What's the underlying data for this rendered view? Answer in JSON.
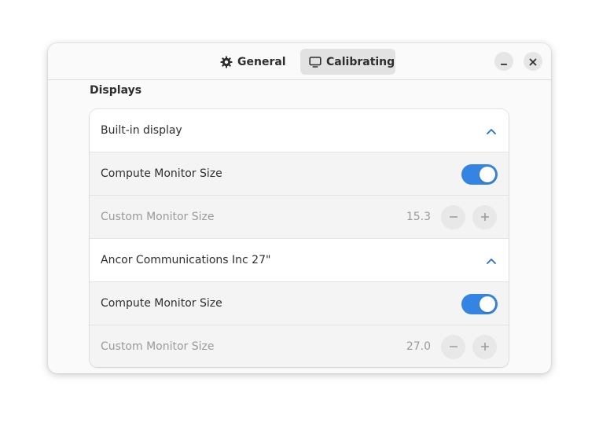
{
  "header": {
    "tabs": [
      {
        "label": "General",
        "icon": "gear-icon",
        "active": false
      },
      {
        "label": "Calibrating",
        "icon": "monitor-icon",
        "active": true
      }
    ],
    "controls": {
      "minimize_icon": "minimize-icon",
      "close_icon": "close-icon"
    }
  },
  "main": {
    "section_title": "Displays",
    "displays": [
      {
        "name": "Built-in display",
        "expanded": true,
        "compute_label": "Compute Monitor Size",
        "compute_enabled": true,
        "custom_label": "Custom Monitor Size",
        "custom_value": "15.3"
      },
      {
        "name": "Ancor Communications Inc 27\"",
        "expanded": true,
        "compute_label": "Compute Monitor Size",
        "compute_enabled": true,
        "custom_label": "Custom Monitor Size",
        "custom_value": "27.0"
      }
    ]
  },
  "colors": {
    "accent": "#3584e4",
    "chevron": "#1c71d8",
    "dim_text": "#9a9a9a"
  }
}
